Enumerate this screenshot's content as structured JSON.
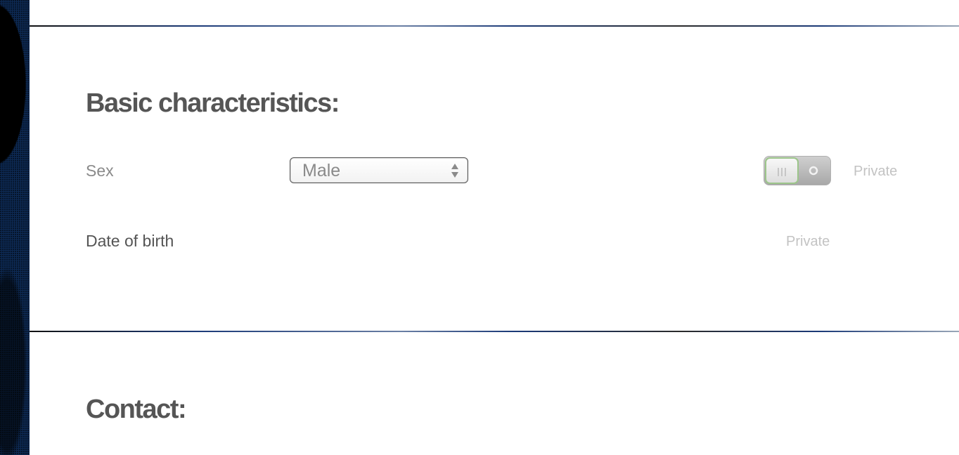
{
  "basic": {
    "heading": "Basic characteristics:",
    "sex": {
      "label": "Sex",
      "selected_value": "Male",
      "private_label": "Private",
      "private_toggle_on": true
    },
    "dob": {
      "label": "Date of birth",
      "private_label": "Private"
    }
  },
  "contact": {
    "heading": "Contact:"
  },
  "icons": {
    "select_arrows": "up-down-arrows-icon",
    "toggle_grip": "grip-lines-icon",
    "toggle_off": "circle-icon"
  },
  "colors": {
    "heading": "#555555",
    "label": "#8a8a8a",
    "private_label": "#c3c3c3",
    "toggle_accent": "#9cc58a",
    "side_background": "#0d2a55"
  }
}
